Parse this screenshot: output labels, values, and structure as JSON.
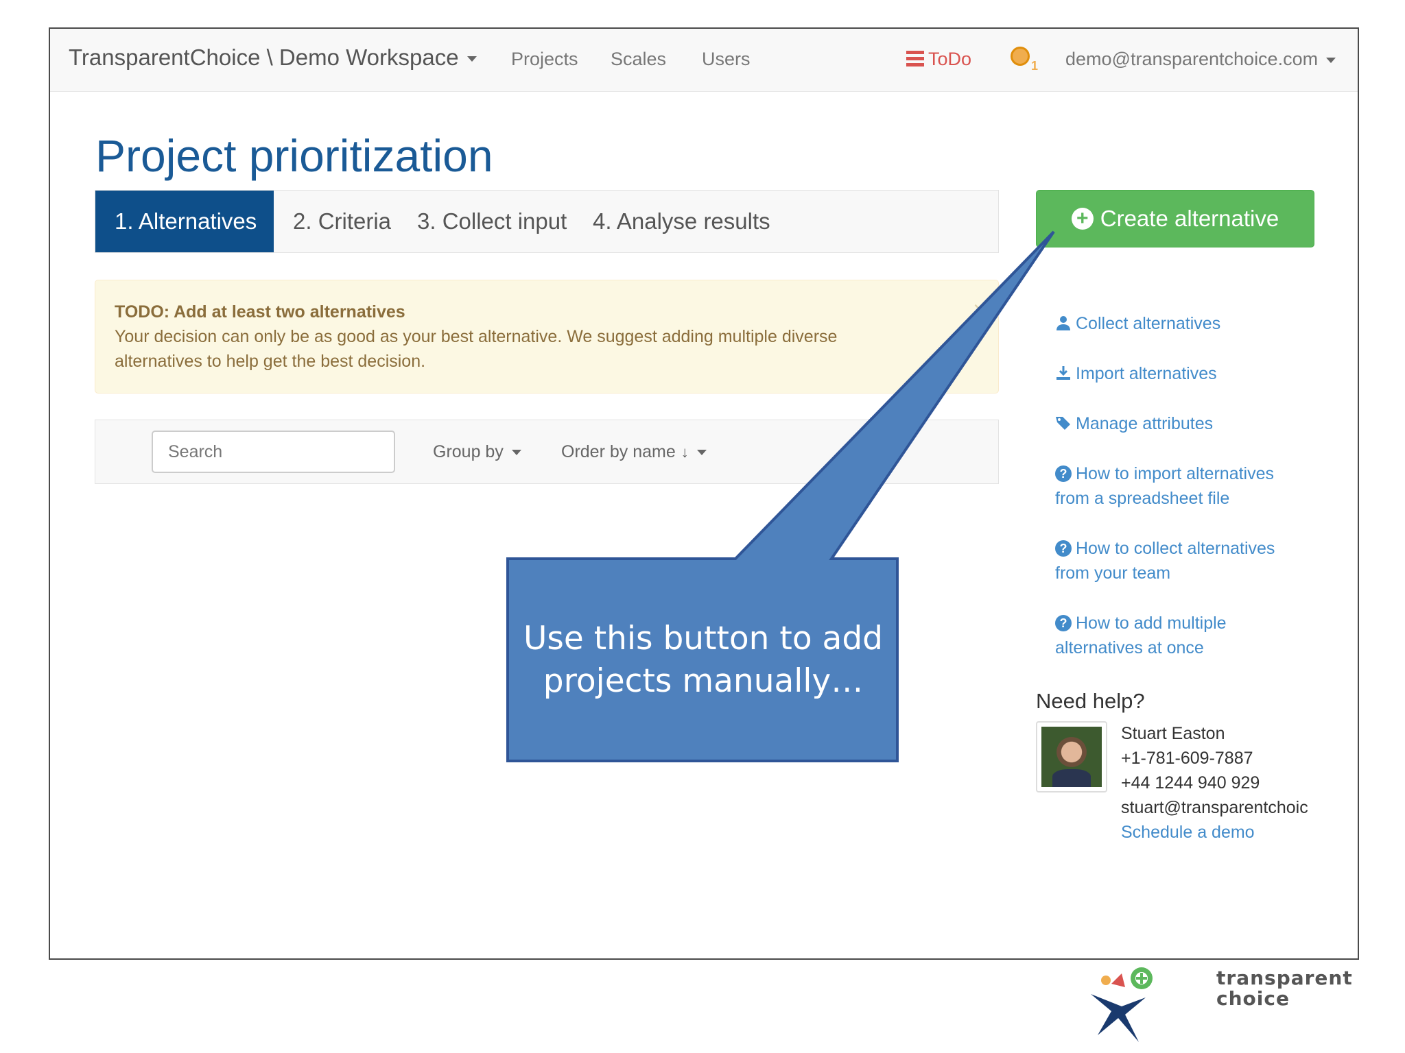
{
  "navbar": {
    "brand": "TransparentChoice \\ Demo Workspace",
    "links": [
      "Projects",
      "Scales",
      "Users"
    ],
    "todo_label": "ToDo",
    "notification_count": "1",
    "user_email": "demo@transparentchoice.com"
  },
  "page": {
    "title": "Project prioritization"
  },
  "tabs": [
    {
      "label": "1. Alternatives",
      "active": true
    },
    {
      "label": "2. Criteria",
      "active": false
    },
    {
      "label": "3. Collect input",
      "active": false
    },
    {
      "label": "4. Analyse results",
      "active": false
    }
  ],
  "create_button": {
    "label": "Create alternative"
  },
  "alert": {
    "title": "TODO: Add at least two alternatives",
    "body": "Your decision can only be as good as your best alternative. We suggest adding multiple diverse alternatives to help get the best decision.",
    "close": "×"
  },
  "toolbar": {
    "search_placeholder": "Search",
    "group_by": "Group by",
    "order_by": "Order by name"
  },
  "side_links": {
    "collect": "Collect alternatives",
    "import": "Import alternatives",
    "manage": "Manage attributes",
    "howto_import_1": "How to import alternatives",
    "howto_import_2": "from a spreadsheet file",
    "howto_collect_1": "How to collect alternatives",
    "howto_collect_2": "from your team",
    "howto_add_1": "How to add multiple",
    "howto_add_2": "alternatives at once"
  },
  "help": {
    "heading": "Need help?",
    "name": "Stuart Easton",
    "phone_us": "+1-781-609-7887",
    "phone_uk": "+44 1244 940 929",
    "email": "stuart@transparentchoic",
    "schedule": "Schedule a demo"
  },
  "callout": {
    "text": "Use this button to add projects manually…",
    "fill": "#4f81bd",
    "stroke": "#2f5597"
  },
  "footer_logo": {
    "text": "transparent\nchoice"
  },
  "colors": {
    "primary": "#0e4f8a",
    "success": "#5cb85c",
    "link": "#428bca",
    "warning_bg": "#fcf8e3",
    "danger": "#d9534f"
  }
}
